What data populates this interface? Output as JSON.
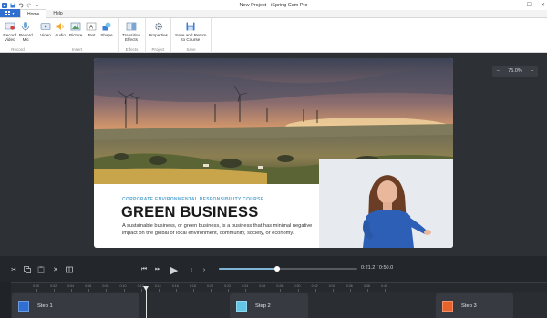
{
  "window": {
    "title": "New Project - iSpring Cam Pro",
    "controls": [
      "minimize",
      "maximize",
      "close"
    ]
  },
  "ribbon": {
    "file_menu_icon": "menu-grid-icon",
    "tabs": [
      {
        "label": "Home",
        "active": true
      },
      {
        "label": "Help",
        "active": false
      }
    ],
    "groups": [
      {
        "name": "Record",
        "buttons": [
          {
            "label": "Record\nVideo",
            "icon": "record-video-icon"
          },
          {
            "label": "Record\nMic",
            "icon": "microphone-icon"
          }
        ]
      },
      {
        "name": "Insert",
        "buttons": [
          {
            "label": "Video",
            "icon": "video-icon"
          },
          {
            "label": "Audio",
            "icon": "speaker-icon"
          },
          {
            "label": "Picture",
            "icon": "picture-icon"
          },
          {
            "label": "Text",
            "icon": "text-icon"
          },
          {
            "label": "Shape",
            "icon": "shape-icon"
          }
        ]
      },
      {
        "name": "Effects",
        "buttons": [
          {
            "label": "Transition\nEffects",
            "icon": "transition-icon"
          }
        ]
      },
      {
        "name": "Project",
        "buttons": [
          {
            "label": "Properties",
            "icon": "gear-icon"
          }
        ]
      },
      {
        "name": "Save",
        "buttons": [
          {
            "label": "Save and Return\nto Course",
            "icon": "save-icon"
          }
        ]
      }
    ]
  },
  "zoom": {
    "value": "75.0%",
    "minus": "−",
    "plus": "+"
  },
  "slide": {
    "subtitle": "CORPORATE ENVIRONMENTAL RESPONSIBILITY COURSE",
    "heading": "GREEN BUSINESS",
    "body": "A sustainable business, or green business, is a business that has minimal negative impact on the global or local environment, community, society, or economy."
  },
  "player": {
    "timecode": "0:21.2 / 0:50.0",
    "progress_fraction": 0.42
  },
  "timeline": {
    "ticks": [
      "0:00",
      "0:02",
      "0:04",
      "0:06",
      "0:08",
      "0:10",
      "0:12",
      "0:14",
      "0:16",
      "0:18",
      "0:20",
      "0:22",
      "0:24",
      "0:26",
      "0:28",
      "0:30",
      "0:32",
      "0:34",
      "0:36",
      "0:38",
      "0:40"
    ],
    "steps": [
      {
        "label": "Step 1",
        "color": "#2f6fd1"
      },
      {
        "label": "Step 2",
        "color": "#62c6e6"
      },
      {
        "label": "Step 3",
        "color": "#e8622c"
      }
    ]
  },
  "colors": {
    "accent": "#2f6fd1",
    "workspace": "#2d3035",
    "subtitle": "#5aa5d0"
  }
}
